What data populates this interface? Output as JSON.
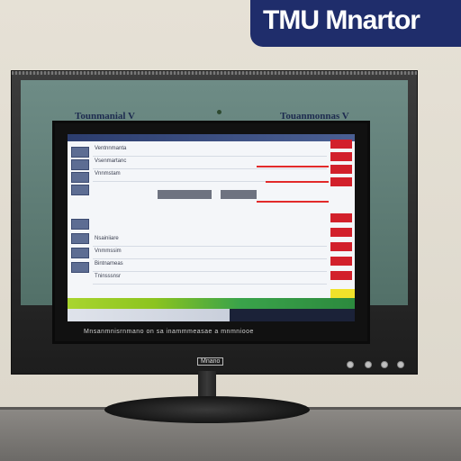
{
  "brand": {
    "badge_text": "TMU Mnartor",
    "bezel_logo_left": "Tounmanial V",
    "bezel_logo_right": "Touanmonnas V"
  },
  "screen": {
    "row_labels": [
      "Ventnnmanta",
      "Vsenmartanc",
      "Vnnmstam",
      "Nsainiiare",
      "Vnmmssim",
      "Bintnameas",
      "Tninsssnsr"
    ],
    "caption": "Mnsanmnisrnmano on sa inammmeasae a mnmniooe"
  },
  "monitor": {
    "model_label": "Mnano"
  },
  "colors": {
    "badge": "#1f2d6b",
    "alert_red": "#d2202b",
    "status_green": "#3aa34a",
    "highlight_yellow": "#f0e22a"
  }
}
